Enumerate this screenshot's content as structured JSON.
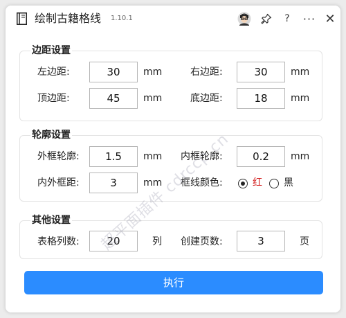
{
  "window": {
    "title": "绘制古籍格线",
    "version": "1.10.1",
    "buttons": {
      "help": "?",
      "more": "···",
      "close": "✕"
    }
  },
  "margins": {
    "title": "边距设置",
    "left_label": "左边距:",
    "left_value": "30",
    "left_unit": "mm",
    "right_label": "右边距:",
    "right_value": "30",
    "right_unit": "mm",
    "top_label": "顶边距:",
    "top_value": "45",
    "top_unit": "mm",
    "bottom_label": "底边距:",
    "bottom_value": "18",
    "bottom_unit": "mm"
  },
  "outline": {
    "title": "轮廓设置",
    "outer_label": "外框轮廓:",
    "outer_value": "1.5",
    "outer_unit": "mm",
    "inner_label": "内框轮廓:",
    "inner_value": "0.2",
    "inner_unit": "mm",
    "gap_label": "内外框距:",
    "gap_value": "3",
    "gap_unit": "mm",
    "color_label": "框线颜色:",
    "color_options": [
      {
        "label": "红",
        "checked": true
      },
      {
        "label": "黑",
        "checked": false
      }
    ]
  },
  "other": {
    "title": "其他设置",
    "columns_label": "表格列数:",
    "columns_value": "20",
    "columns_unit": "列",
    "pages_label": "创建页数:",
    "pages_value": "3",
    "pages_unit": "页"
  },
  "execute_label": "执行",
  "watermark": "超平面插件 cdrccp.cn",
  "colors": {
    "accent": "#2b8cff",
    "red_option": "#d42020"
  }
}
